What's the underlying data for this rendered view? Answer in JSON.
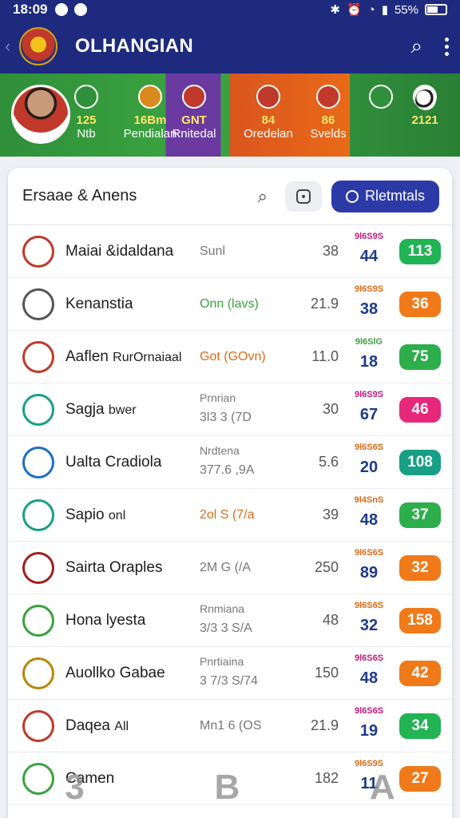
{
  "status_bar": {
    "time": "18:09",
    "battery": "55%"
  },
  "app_bar": {
    "title": "OLHANGIAN",
    "back_icon": "chevron-left-icon",
    "search_icon": "search-icon",
    "menu_icon": "more-vertical-icon"
  },
  "banner": {
    "teams": [
      {
        "top": "125",
        "bottom": "Ntb",
        "color": "#2f8f3a"
      },
      {
        "top": "16Bm",
        "bottom": "Pendialan",
        "color": "#d98a1e"
      },
      {
        "top": "GNT",
        "bottom": "Rnitedal",
        "color": "#c0392b"
      },
      {
        "top": "84",
        "bottom": "Oredelan",
        "color": "#c0392b"
      },
      {
        "top": "86",
        "bottom": "Svelds",
        "color": "#c0392b"
      },
      {
        "top": "",
        "bottom": "",
        "color": "#2f8f3a"
      },
      {
        "top": "2121",
        "bottom": "",
        "color": "#ffffff"
      }
    ]
  },
  "card": {
    "title": "Ersaae & Anens",
    "primary_button": "Rletmtals",
    "rows": [
      {
        "name": "Maiai &idaldana",
        "sub_top": "",
        "sub": "Sunl",
        "sub_color": "#777",
        "n1": "38",
        "small": "9l6S9S",
        "small_color": "#c2187a",
        "n2": "44",
        "pill": "113",
        "pill_color": "#21b354",
        "crest_color": "#c0392b"
      },
      {
        "name": "Kenanstia",
        "sub_top": "",
        "sub": "Onn (lavs)",
        "sub_color": "#3aa13f",
        "n1": "21.9",
        "small": "9l6S9S",
        "small_color": "#e06a18",
        "n2": "38",
        "pill": "36",
        "pill_color": "#f07a1a",
        "crest_color": "#555"
      },
      {
        "name": "Aaflen",
        "name2": "RurOrnaiaal",
        "sub_top": "",
        "sub": "Got (GOvn)",
        "sub_color": "#e06a18",
        "n1": "11.0",
        "small": "9l6SlG",
        "small_color": "#3aa13f",
        "n2": "18",
        "pill": "75",
        "pill_color": "#2cae4a",
        "crest_color": "#c0392b"
      },
      {
        "name": "Sagja",
        "name2": "bwer",
        "sub_top": "Prnrian",
        "sub": "3l3 3 (7D",
        "sub_color": "#777",
        "n1": "30",
        "small": "9l6S9S",
        "small_color": "#c2187a",
        "n2": "67",
        "pill": "46",
        "pill_color": "#e6287a",
        "crest_color": "#17a085"
      },
      {
        "name": "Ualta Cradiola",
        "sub_top": "Nrdtena",
        "sub": "377.6 ,9A",
        "sub_color": "#777",
        "n1": "5.6",
        "small": "9l6S6S",
        "small_color": "#e06a18",
        "n2": "20",
        "pill": "108",
        "pill_color": "#17a085",
        "crest_color": "#1a6fc0"
      },
      {
        "name": "Sapio",
        "name2": "onl",
        "sub_top": "",
        "sub": "2ol S (7/a",
        "sub_color": "#e06a18",
        "n1": "39",
        "small": "9l4SnS",
        "small_color": "#e06a18",
        "n2": "48",
        "pill": "37",
        "pill_color": "#2cae4a",
        "crest_color": "#17a085"
      },
      {
        "name": "Sairta Oraples",
        "sub_top": "",
        "sub": "2M G (/A",
        "sub_color": "#777",
        "n1": "250",
        "small": "9l6S6S",
        "small_color": "#e06a18",
        "n2": "89",
        "pill": "32",
        "pill_color": "#f07a1a",
        "crest_color": "#a01f1f"
      },
      {
        "name": "Hona lyesta",
        "sub_top": "Rnmiana",
        "sub": "3/3 3 S/A",
        "sub_color": "#777",
        "n1": "48",
        "small": "9l6S6S",
        "small_color": "#e06a18",
        "n2": "32",
        "pill": "158",
        "pill_color": "#f07a1a",
        "crest_color": "#3aa13f"
      },
      {
        "name": "Auollko Gabae",
        "sub_top": "Pnrtiaina",
        "sub": "3 7/3 S/74",
        "sub_color": "#777",
        "n1": "150",
        "small": "9l6S6S",
        "small_color": "#c2187a",
        "n2": "48",
        "pill": "42",
        "pill_color": "#f07a1a",
        "crest_color": "#b8860b"
      },
      {
        "name": "Daqea",
        "name2": "All",
        "sub_top": "",
        "sub": "Mn1 6 (OS",
        "sub_color": "#777",
        "n1": "21.9",
        "small": "9l6S6S",
        "small_color": "#c2187a",
        "n2": "19",
        "pill": "34",
        "pill_color": "#21b354",
        "crest_color": "#c0392b"
      },
      {
        "name": "Camen",
        "sub_top": "",
        "sub": "",
        "sub_color": "#777",
        "n1": "182",
        "small": "9l6S9S",
        "small_color": "#e06a18",
        "n2": "11",
        "pill": "27",
        "pill_color": "#f07a1a",
        "crest_color": "#3aa13f"
      }
    ]
  },
  "bottom_nav": {
    "items": [
      "3",
      "B",
      "A"
    ]
  }
}
